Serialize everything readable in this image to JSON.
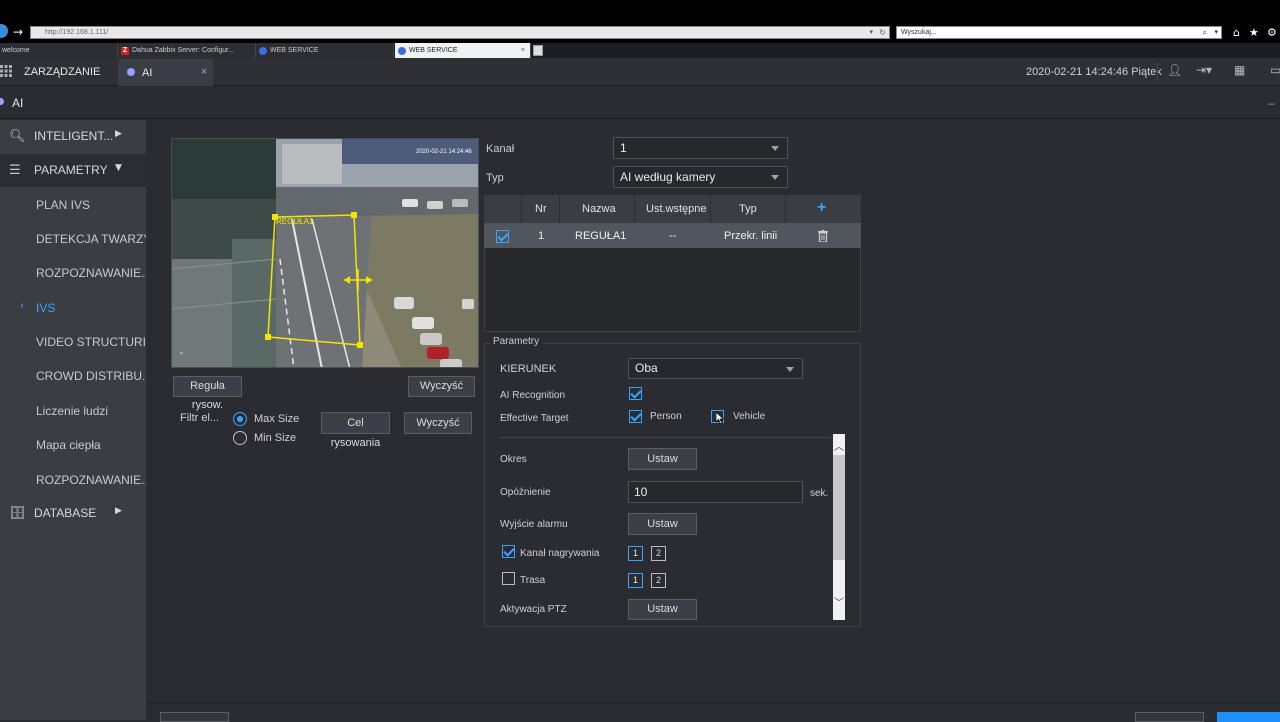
{
  "browser": {
    "url": "http://192.168.1.111/",
    "search_placeholder": "Wyszukaj...",
    "tabs": [
      {
        "label": "welcome"
      },
      {
        "label": "Dahua Zabbix Server: Configur..."
      },
      {
        "label": "WEB SERVICE"
      },
      {
        "label": "WEB SERVICE"
      }
    ]
  },
  "header": {
    "title": "ZARZĄDZANIE",
    "tab_label": "AI",
    "datetime": "2020-02-21 14:24:46 Piątek"
  },
  "breadcrumb": {
    "title": "AI"
  },
  "sidebar": {
    "groups": [
      {
        "label": "INTELIGENT..."
      },
      {
        "label": "PARAMETRY"
      },
      {
        "label": "DATABASE"
      }
    ],
    "items": [
      {
        "label": "PLAN IVS"
      },
      {
        "label": "DETEKCJA TWARZY"
      },
      {
        "label": "ROZPOZNAWANIE..."
      },
      {
        "label": "IVS"
      },
      {
        "label": "VIDEO STRUCTURI..."
      },
      {
        "label": "CROWD DISTRIBU..."
      },
      {
        "label": "Liczenie ludzi"
      },
      {
        "label": "Mapa ciepła"
      },
      {
        "label": "ROZPOZNAWANIE..."
      }
    ]
  },
  "video": {
    "rule_label": "REGUŁA1",
    "timestamp": "2020-02-21 14:24:46"
  },
  "video_controls": {
    "draw_rule_btn": "Reguła rysow.",
    "clear_btn": "Wyczyść",
    "filter_label": "Filtr el...",
    "max_size": "Max Size",
    "min_size": "Min Size",
    "draw_target_btn": "Cel rysowania",
    "clear_btn2": "Wyczyść"
  },
  "form": {
    "channel_label": "Kanał",
    "channel_value": "1",
    "type_label": "Typ",
    "type_value": "AI według kamery"
  },
  "rule_table": {
    "headers": [
      "Nr",
      "Nazwa",
      "Ust.wstępne",
      "Typ"
    ],
    "add_label": "+",
    "rows": [
      {
        "nr": "1",
        "nazwa": "REGUŁA1",
        "preset": "--",
        "typ": "Przekr. linii"
      }
    ]
  },
  "params": {
    "legend": "Parametry",
    "direction_label": "KIERUNEK",
    "direction_value": "Oba",
    "ai_recognition_label": "AI Recognition",
    "effective_target_label": "Effective Target",
    "person_label": "Person",
    "vehicle_label": "Vehicle",
    "period_label": "Okres",
    "set_label": "Ustaw",
    "delay_label": "Opóźnienie",
    "delay_value": "10",
    "delay_unit": "sek.",
    "alarm_out_label": "Wyjście alarmu",
    "record_channel_label": "Kanał nagrywania",
    "tour_label": "Trasa",
    "ptz_label": "Aktywacja PTZ",
    "channels": [
      "1",
      "2"
    ]
  },
  "colors": {
    "accent": "#38a4ff",
    "rule_yellow": "#f2e600"
  }
}
